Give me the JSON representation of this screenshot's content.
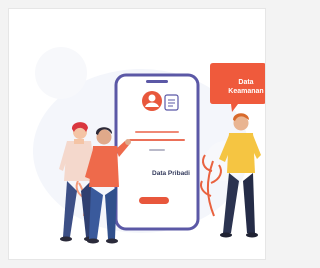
{
  "bubble": {
    "line1": "Data",
    "line2": "Keamanan"
  },
  "phone": {
    "title": "Data Pribadi"
  },
  "colors": {
    "accent": "#e8573c",
    "phone_outline": "#5b58a6",
    "bubble": "#ef5a3c",
    "plant": "#e9623f"
  },
  "icons": [
    "user-icon",
    "document-icon"
  ]
}
